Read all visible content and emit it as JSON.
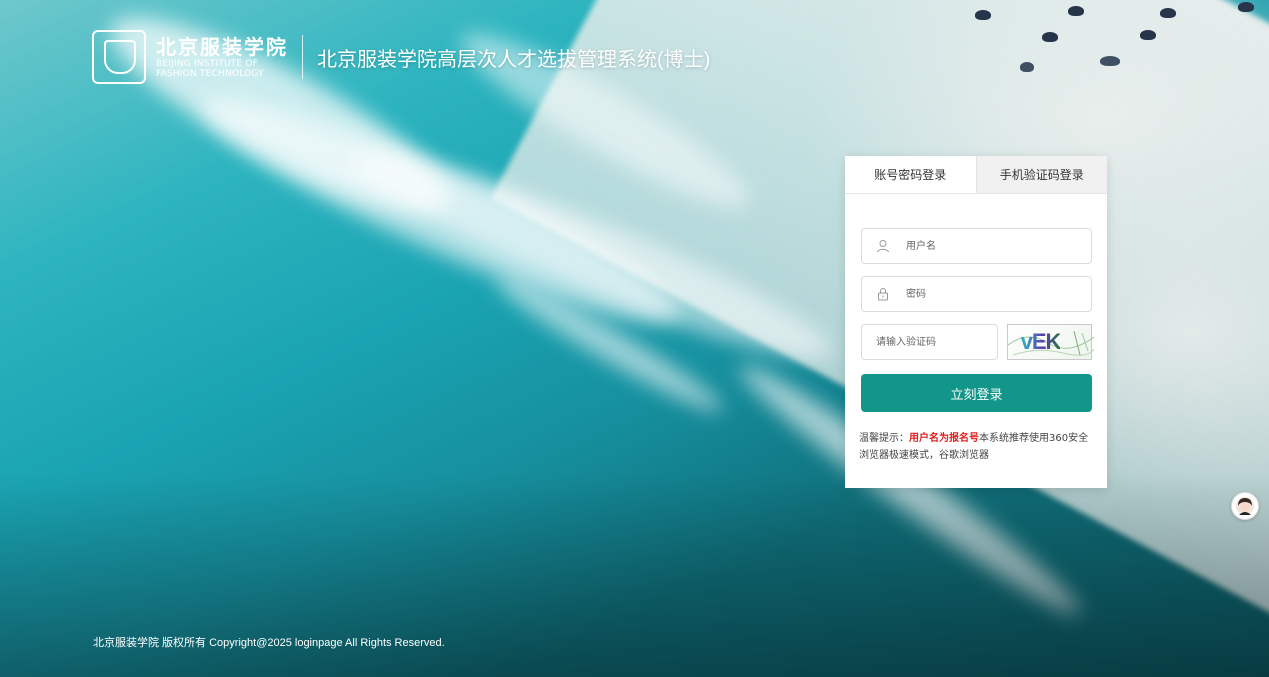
{
  "header": {
    "logo_cn": "北京服装学院",
    "logo_en_line1": "BEIJING INSTITUTE OF",
    "logo_en_line2": "FASHION TECHNOLOGY",
    "system_title": "北京服装学院高层次人才选拔管理系统(博士)"
  },
  "login": {
    "tabs": [
      {
        "label": "账号密码登录",
        "active": true
      },
      {
        "label": "手机验证码登录",
        "active": false
      }
    ],
    "username_placeholder": "用户名",
    "password_placeholder": "密码",
    "captcha_placeholder": "请输入验证码",
    "captcha_text": "vEK",
    "submit_label": "立刻登录",
    "tip_prefix": "温馨提示：",
    "tip_highlight": "用户名为报名号",
    "tip_rest": "本系统推荐使用360安全浏览器极速模式，谷歌浏览器"
  },
  "footer": {
    "text": "北京服装学院 版权所有 Copyright@2025 loginpage All Rights Reserved."
  },
  "colors": {
    "primary_button": "#12968a",
    "tip_highlight": "#e02020"
  }
}
